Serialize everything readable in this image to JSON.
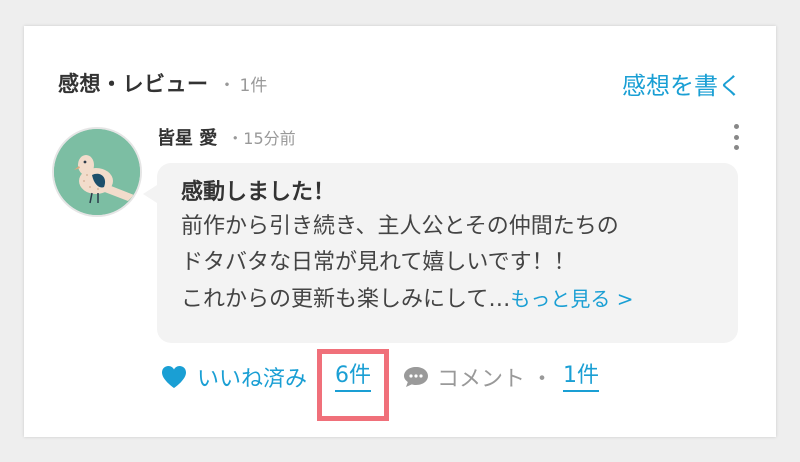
{
  "section": {
    "title": "感想・レビュー",
    "count": "1件",
    "write_link": "感想を書く"
  },
  "review": {
    "author": "皆星 愛",
    "time": "15分前",
    "title": "感動しました！",
    "lines": [
      "前作から引き続き、主人公とその仲間たちの",
      "ドタバタな日常が見れて嬉しいです！！",
      "これからの更新も楽しみにして…"
    ],
    "read_more": "もっと見る >"
  },
  "actions": {
    "like_label": "いいね済み",
    "like_count": "6件",
    "comment_label": "コメント",
    "comment_count": "1件"
  },
  "colors": {
    "accent": "#1a9fd4",
    "highlight": "#f0707a",
    "avatar_bg": "#7cbea3"
  },
  "icons": {
    "like": "heart-icon",
    "comment": "speech-bubble-icon",
    "menu": "vertical-dots-icon",
    "avatar": "bird-illustration"
  }
}
